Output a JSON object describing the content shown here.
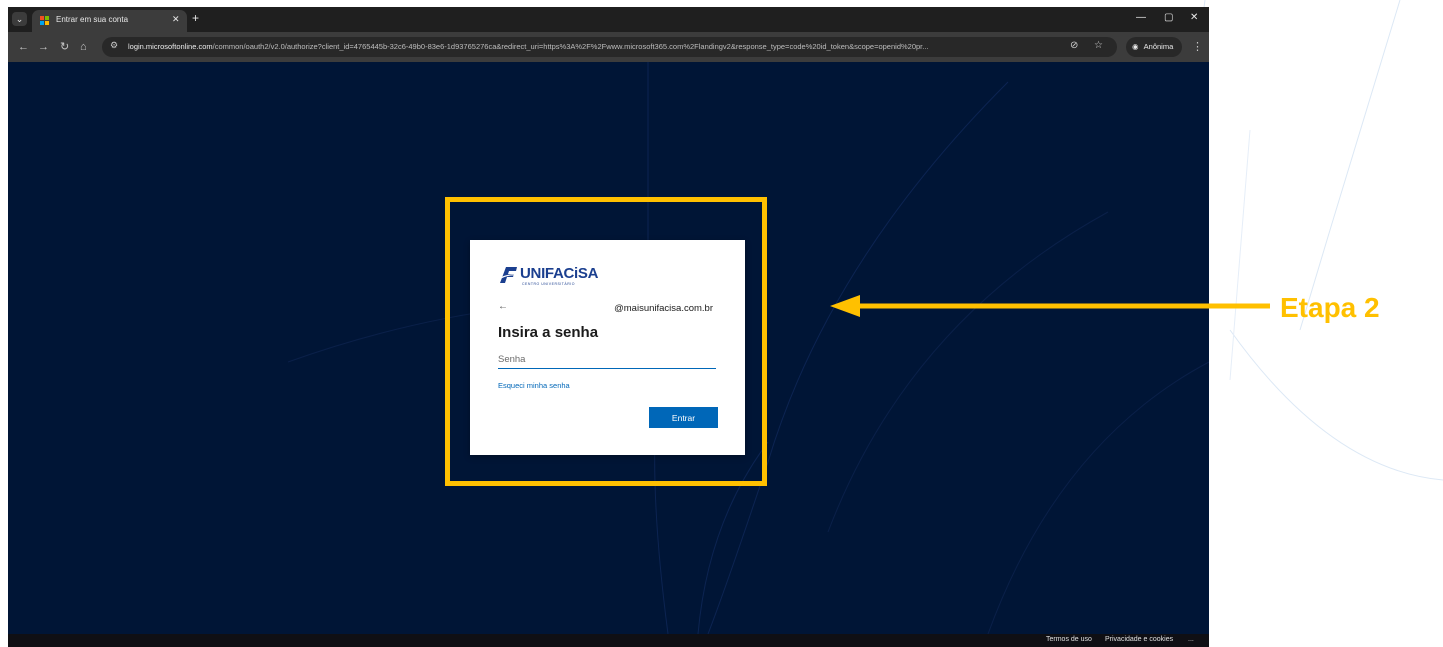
{
  "browser": {
    "tab": {
      "title": "Entrar em sua conta"
    },
    "address": {
      "domain": "login.microsoftonline.com",
      "path": "/common/oauth2/v2.0/authorize?client_id=4765445b-32c6-49b0-83e6-1d93765276ca&redirect_uri=https%3A%2F%2Fwww.microsoft365.com%2Flandingv2&response_type=code%20id_token&scope=openid%20pr..."
    },
    "profile_label": "Anônima"
  },
  "signin": {
    "logo_text": "UNIFACiSA",
    "logo_subtitle": "CENTRO UNIVERSITÁRIO",
    "identity": "@maisunifacisa.com.br",
    "heading": "Insira a senha",
    "password_placeholder": "Senha",
    "forgot_link": "Esqueci minha senha",
    "submit_label": "Entrar"
  },
  "footer": {
    "terms": "Termos de uso",
    "privacy": "Privacidade e cookies",
    "more": "..."
  },
  "annotation": {
    "label": "Etapa 2",
    "color": "#ffc000"
  },
  "colors": {
    "page_bg": "#001536",
    "accent": "#0067b8"
  }
}
